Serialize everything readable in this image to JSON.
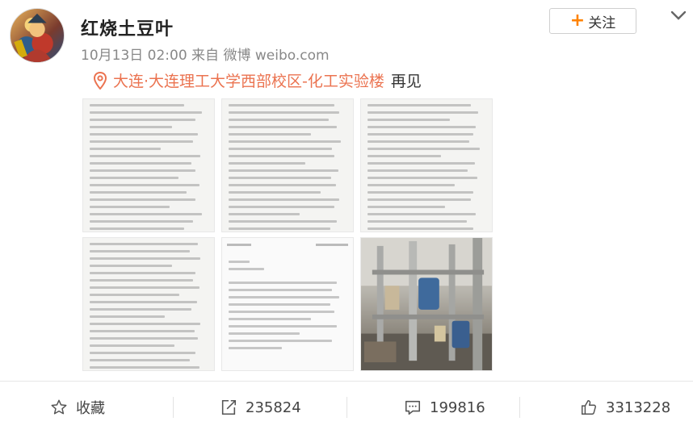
{
  "post": {
    "username": "红烧土豆叶",
    "meta": "10月13日 02:00 来自 微博 weibo.com",
    "follow_label": "关注",
    "location": {
      "place": "大连·大连理工大学西部校区-化工实验楼",
      "suffix": "再见"
    }
  },
  "images": [
    {
      "kind": "text-screenshot",
      "icon": "document-icon"
    },
    {
      "kind": "text-screenshot",
      "icon": "document-icon"
    },
    {
      "kind": "text-screenshot",
      "icon": "document-icon"
    },
    {
      "kind": "text-screenshot",
      "icon": "document-icon"
    },
    {
      "kind": "phone-screenshot",
      "icon": "document-icon"
    },
    {
      "kind": "photo",
      "icon": "lab-equipment-photo"
    }
  ],
  "toolbar": {
    "favorite_label": "收藏",
    "share_count": "235824",
    "comment_count": "199816",
    "like_count": "3313228"
  },
  "colors": {
    "accent": "#ff8200",
    "location": "#eb7350",
    "text": "#333333",
    "muted": "#888888"
  }
}
